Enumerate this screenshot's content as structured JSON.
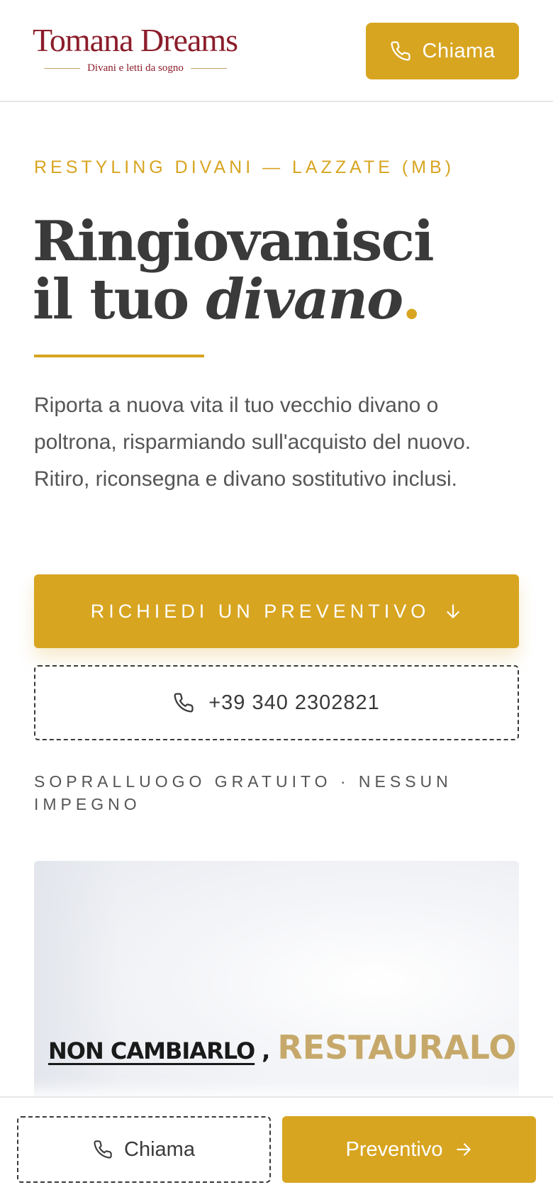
{
  "header": {
    "logo_main": "Tomana Dreams",
    "logo_sub": "Divani e letti da sogno",
    "call_label": "Chiama"
  },
  "hero": {
    "eyebrow": "RESTYLING DIVANI — LAZZATE (MB)",
    "title_line1": "Ringiovanisci",
    "title_line2_plain": "il tuo ",
    "title_line2_italic": "divano",
    "title_dot": ".",
    "lead": "Riporta a nuova vita il tuo vecchio divano o poltrona, risparmiando sull'acquisto del nuovo. Ritiro, riconsegna e divano sostitutivo inclusi.",
    "quote_button": "RICHIEDI UN PREVENTIVO",
    "phone_button": "+39 340 2302821",
    "note": "SOPRALLUOGO GRATUITO · NESSUN IMPEGNO"
  },
  "promo": {
    "text_a": "NON CAMBIARLO",
    "text_comma": ",",
    "text_b": "RESTAURALO!"
  },
  "bottom_bar": {
    "call_label": "Chiama",
    "quote_label": "Preventivo"
  },
  "colors": {
    "accent": "#d8a521",
    "brand": "#8b1d2a",
    "text": "#3a3a3a"
  },
  "icons": {
    "call": "phone-icon",
    "down": "arrow-down-icon",
    "right": "arrow-right-icon"
  }
}
